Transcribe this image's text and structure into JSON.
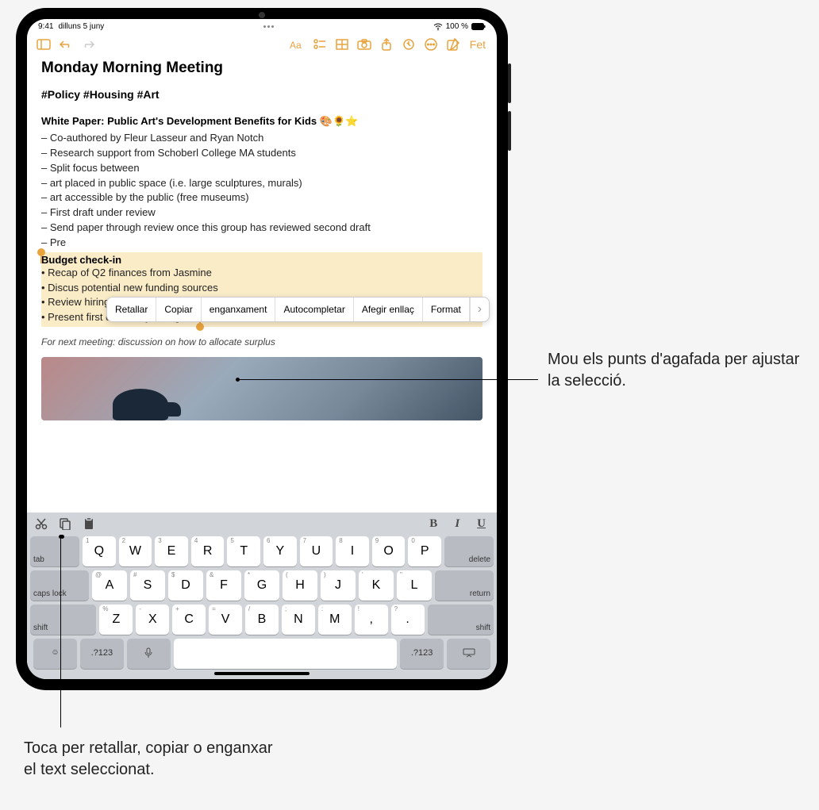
{
  "status": {
    "time": "9:41",
    "date": "dilluns 5 juny",
    "battery": "100 %"
  },
  "toolbar": {
    "done": "Fet"
  },
  "note": {
    "title": "Monday Morning Meeting",
    "tags": "#Policy #Housing #Art",
    "subtitle": "White Paper: Public Art's Development Benefits for Kids 🎨🌻⭐",
    "lines": [
      "– Co-authored by Fleur Lasseur and Ryan Notch",
      "– Research support from Schoberl College MA students",
      "– Split focus between",
      "– art placed in public space (i.e. large sculptures, murals)",
      "– art accessible by the public (free museums)",
      "– First draft under review",
      "– Send paper through review once this group has reviewed second draft",
      "– Pre"
    ],
    "selection": {
      "title": "Budget check-in",
      "items": [
        "• Recap of Q2 finances from Jasmine",
        "• Discus potential new funding sources",
        "• Review hiring needs",
        "• Present first draft of Q3 budget"
      ]
    },
    "footer": "For next meeting: discussion on how to allocate surplus"
  },
  "context_menu": {
    "items": [
      "Retallar",
      "Copiar",
      "enganxament",
      "Autocompletar",
      "Afegir enllaç",
      "Format"
    ]
  },
  "keyboard": {
    "format": {
      "bold": "B",
      "italic": "I",
      "underline": "U"
    },
    "row1": {
      "tab": "tab",
      "keys": [
        {
          "m": "Q",
          "a": "1"
        },
        {
          "m": "W",
          "a": "2"
        },
        {
          "m": "E",
          "a": "3"
        },
        {
          "m": "R",
          "a": "4"
        },
        {
          "m": "T",
          "a": "5"
        },
        {
          "m": "Y",
          "a": "6"
        },
        {
          "m": "U",
          "a": "7"
        },
        {
          "m": "I",
          "a": "8"
        },
        {
          "m": "O",
          "a": "9"
        },
        {
          "m": "P",
          "a": "0"
        }
      ],
      "delete": "delete"
    },
    "row2": {
      "caps": "caps lock",
      "keys": [
        {
          "m": "A",
          "a": "@"
        },
        {
          "m": "S",
          "a": "#"
        },
        {
          "m": "D",
          "a": "$"
        },
        {
          "m": "F",
          "a": "&"
        },
        {
          "m": "G",
          "a": "*"
        },
        {
          "m": "H",
          "a": "("
        },
        {
          "m": "J",
          "a": ")"
        },
        {
          "m": "K",
          "a": "'"
        },
        {
          "m": "L",
          "a": "\""
        }
      ],
      "return": "return"
    },
    "row3": {
      "shift_l": "shift",
      "keys": [
        {
          "m": "Z",
          "a": "%"
        },
        {
          "m": "X",
          "a": "-"
        },
        {
          "m": "C",
          "a": "+"
        },
        {
          "m": "V",
          "a": "="
        },
        {
          "m": "B",
          "a": "/"
        },
        {
          "m": "N",
          "a": ";"
        },
        {
          "m": "M",
          "a": ":"
        },
        {
          "m": ",",
          "a": "!"
        },
        {
          "m": ".",
          "a": "?"
        }
      ],
      "shift_r": "shift"
    },
    "row4": {
      "numkey": ".?123"
    }
  },
  "callouts": {
    "c1": "Mou els punts d'agafada per ajustar la selecció.",
    "c2": "Toca per retallar, copiar o enganxar el text seleccionat."
  }
}
